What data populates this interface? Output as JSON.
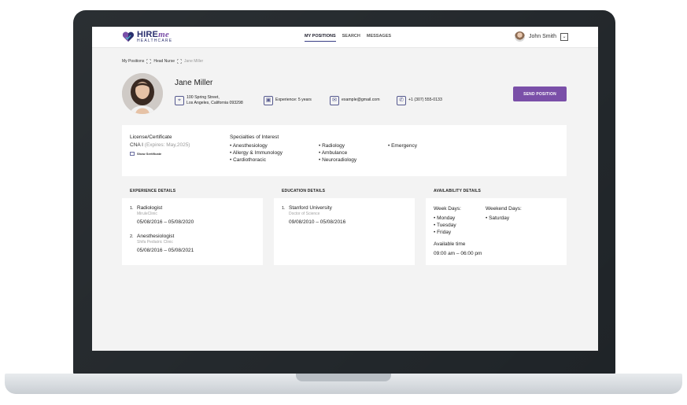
{
  "header": {
    "logo_main": "HIRE",
    "logo_me": "me",
    "logo_sub": "HEALTHCARE",
    "nav": [
      "MY POSITIONS",
      "SEARCH",
      "MESSAGES"
    ],
    "user_name": "John Smith",
    "dropdown_glyph": "⌄"
  },
  "breadcrumb": [
    "My Positions",
    "Head Nurse",
    "Jane Miller"
  ],
  "profile": {
    "name": "Jane Miller",
    "address_line1": "100 Spring Street,",
    "address_line2": "Los Angeles, California 093298",
    "experience": "Experience: 5 years",
    "email": "example@gmail.com",
    "phone": "+1 (307) 555-0133",
    "send_button": "SEND POSITION"
  },
  "license": {
    "label": "License/Certificate",
    "value": "CNA I",
    "expires": "(Expires: May,2025)",
    "show_link": "Show Sertificate"
  },
  "specialties": {
    "label": "Specialties of Interest",
    "col1": [
      "• Anesthesiology",
      "• Allergy & Immunology",
      "• Cardiothoracic"
    ],
    "col2": [
      "• Radiology",
      "• Ambulance",
      "• Neuroradiology"
    ],
    "col3": [
      "• Emergency"
    ]
  },
  "experience_details": {
    "title": "EXPERIENCE DETAILS",
    "items": [
      {
        "num": "1.",
        "role": "Radiologist",
        "org": "MiruleClinic",
        "dates": "05/08/2016 – 05/08/2020"
      },
      {
        "num": "2.",
        "role": "Anesthesiologist",
        "org": "Shifa Pediatric Clinic",
        "dates": "05/08/2016 – 05/08/2021"
      }
    ]
  },
  "education_details": {
    "title": "EDUCATION DETAILS",
    "items": [
      {
        "num": "1.",
        "school": "Stanford University",
        "degree": "Doctor of Science",
        "dates": "09/08/2010 – 05/08/2016"
      }
    ]
  },
  "availability": {
    "title": "AVAILABILITY DETAILS",
    "week_label": "Week Days:",
    "week_days": [
      "• Monday",
      "• Tuesday",
      "• Friday"
    ],
    "weekend_label": "Weekend Days:",
    "weekend_days": [
      "• Saturday"
    ],
    "time_label": "Available time",
    "time_value": "09:00 am – 06:00 pm"
  },
  "colors": {
    "accent": "#7a4fa8",
    "navy": "#2a2f6e",
    "background": "#f3f3f3"
  }
}
